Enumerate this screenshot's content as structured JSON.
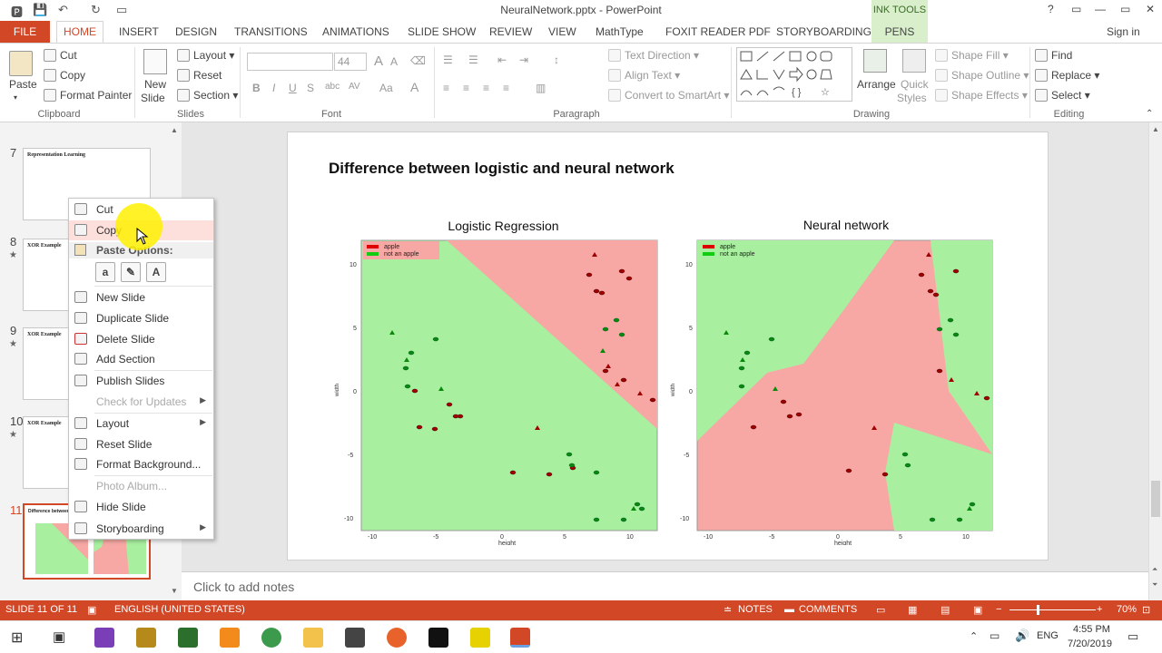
{
  "window": {
    "title": "NeuralNetwork.pptx - PowerPoint",
    "controls": [
      "?",
      "▭",
      "—",
      "▭",
      "✕"
    ],
    "signin": "Sign in"
  },
  "tabs": {
    "file": "FILE",
    "home": "HOME",
    "others": [
      "INSERT",
      "DESIGN",
      "TRANSITIONS",
      "ANIMATIONS",
      "SLIDE SHOW",
      "REVIEW",
      "VIEW",
      "MathType",
      "FOXIT READER PDF",
      "STORYBOARDING"
    ],
    "ink_tools": "INK TOOLS",
    "pens": "PENS"
  },
  "ribbon": {
    "clipboard": {
      "paste": "Paste",
      "cut": "Cut",
      "copy": "Copy",
      "format_painter": "Format Painter",
      "group": "Clipboard"
    },
    "slides": {
      "new_slide_1": "New",
      "new_slide_2": "Slide",
      "layout": "Layout",
      "reset": "Reset",
      "section": "Section",
      "group": "Slides"
    },
    "font": {
      "size": "44",
      "bold": "B",
      "italic": "I",
      "underline": "U",
      "strike": "S",
      "shadow": "abc",
      "spacing": "AV",
      "case": "Aa",
      "color": "A",
      "group": "Font"
    },
    "paragraph": {
      "text_direction": "Text Direction",
      "align_text": "Align Text",
      "convert_smartart": "Convert to SmartArt",
      "group": "Paragraph"
    },
    "drawing": {
      "arrange": "Arrange",
      "quick_styles_1": "Quick",
      "quick_styles_2": "Styles",
      "shape_fill": "Shape Fill",
      "shape_outline": "Shape Outline",
      "shape_effects": "Shape Effects",
      "group": "Drawing"
    },
    "editing": {
      "find": "Find",
      "replace": "Replace",
      "select": "Select",
      "group": "Editing"
    }
  },
  "thumbnails": [
    {
      "num": "7",
      "title": "Representation Learning",
      "star": false
    },
    {
      "num": "8",
      "title": "XOR Example",
      "star": true
    },
    {
      "num": "9",
      "title": "XOR Example",
      "star": true
    },
    {
      "num": "10",
      "title": "XOR Example",
      "star": true
    },
    {
      "num": "11",
      "title": "Difference between logistic and neural network",
      "star": false
    }
  ],
  "context_menu": {
    "cut": "Cut",
    "copy": "Copy",
    "paste_options": "Paste Options:",
    "new_slide": "New Slide",
    "duplicate_slide": "Duplicate Slide",
    "delete_slide": "Delete Slide",
    "add_section": "Add Section",
    "publish_slides": "Publish Slides",
    "check_updates": "Check for Updates",
    "layout": "Layout",
    "reset_slide": "Reset Slide",
    "format_background": "Format Background...",
    "photo_album": "Photo Album...",
    "hide_slide": "Hide Slide",
    "storyboarding": "Storyboarding"
  },
  "slide": {
    "title": "Difference between logistic and neural network",
    "left_plot_title": "Logistic Regression",
    "right_plot_title": "Neural network",
    "legend": [
      "apple",
      "not an apple"
    ],
    "xlabel": "height",
    "ylabel": "width",
    "colors": {
      "apple_region": "#f7a8a4",
      "not_apple_region": "#a8f0a0",
      "apple_point": "#a00000",
      "not_apple_point": "#0a8a0a"
    }
  },
  "notes_placeholder": "Click to add notes",
  "statusbar": {
    "slide_info": "SLIDE 11 OF 11",
    "language": "ENGLISH (UNITED STATES)",
    "notes": "NOTES",
    "comments": "COMMENTS",
    "zoom": "70%"
  },
  "taskbar": {
    "time": "4:55 PM",
    "date": "7/20/2019",
    "lang": "ENG"
  }
}
